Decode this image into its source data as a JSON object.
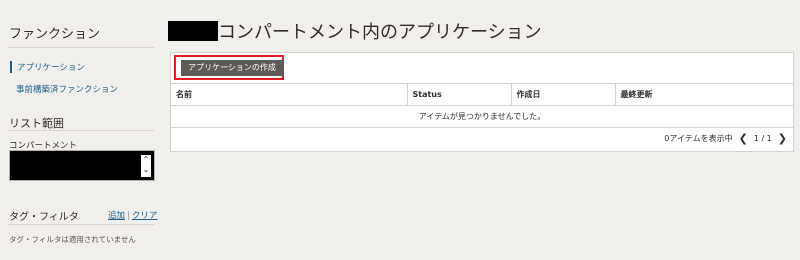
{
  "sidebar": {
    "title": "ファンクション",
    "items": [
      {
        "label": "アプリケーション",
        "active": true
      },
      {
        "label": "事前構築済ファンクション",
        "active": false
      }
    ],
    "list_scope_title": "リスト範囲",
    "compartment_label": "コンパートメント",
    "select_chevron_up": "⌃",
    "select_chevron_down": "⌄",
    "tag_filter_title": "タグ・フィルタ",
    "tag_add": "追加",
    "tag_clear": "クリア",
    "tag_separator": "|",
    "tag_note": "タグ・フィルタは適用されていません"
  },
  "main": {
    "title_suffix": "コンパートメント内のアプリケーション",
    "create_button": "アプリケーションの作成",
    "columns": [
      "名前",
      "Status",
      "作成日",
      "最終更新"
    ],
    "empty_message": "アイテムが見つかりませんでした。",
    "pager": {
      "count_text": "0アイテムを表示中",
      "page_text": "1 / 1",
      "prev_icon": "❮",
      "next_icon": "❯"
    }
  },
  "colors": {
    "background": "#f1efec",
    "link": "#1d5f8a",
    "button": "#5f5c58",
    "highlight": "#e31b23"
  }
}
